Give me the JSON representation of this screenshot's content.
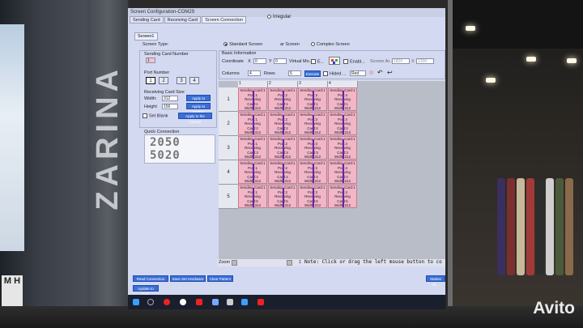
{
  "window": {
    "title": "Screen Configuration-COM29",
    "tabs": [
      "Sending Card",
      "Receiving Card",
      "Screen Connection"
    ],
    "subtab": "Screen1",
    "irregular_label": "Irregular"
  },
  "screen_type": {
    "label": "Screen Type:",
    "options": [
      "Standard Screen",
      "ar Screen",
      "Complex Screen"
    ]
  },
  "sending_card_number": {
    "label": "Sending Card Number",
    "value": "1"
  },
  "port_number": {
    "label": "Port Number",
    "ports": [
      "1",
      "2",
      "3",
      "4"
    ]
  },
  "receiving_card_size": {
    "label": "Receiving Card Size",
    "width_label": "Width:",
    "width_value": "312",
    "height_label": "Height",
    "height_value": "156",
    "apply_all_btn": "Apply to Setting",
    "apply_all_btn2": "Apply to Setting",
    "set_blank_label": "Set Blank",
    "apply_current_btn": "Apply to the Current"
  },
  "quick_connection": {
    "label": "Quick Connection"
  },
  "basic_info": {
    "label": "Basic Information",
    "coordinate_label": "Coordinate",
    "x_label": "X",
    "x_value": "0",
    "y_label": "Y",
    "y_value": "0",
    "virtual_label": "Virtual Mo...",
    "e_label": "E...",
    "enable_label": "Enabl...",
    "screen_ar_label": "Screen Ar...",
    "screen_w": "1820",
    "x_sep": "X",
    "screen_h": "1200",
    "columns_label": "Columns",
    "columns_value": "4",
    "rows_label": "Rows",
    "rows_value": "5",
    "hidden_label": "Hided ...",
    "color_value": "Red",
    "apply_btn": "Execute"
  },
  "grid": {
    "columns": [
      "1",
      "2",
      "3",
      "4"
    ],
    "rows": [
      "1",
      "2",
      "3",
      "4",
      "5"
    ],
    "cells": [
      [
        "Sending Card:1|Port:1|Receiving|Card:1|Width:312",
        "Sending Card:1|Port:2|Receiving|Card:1|Width:312",
        "Sending Card:1|Port:3|Receiving|Card:1|Width:312",
        "Sending Card:1|Port:4|Receiving|Card:1|Width:312"
      ],
      [
        "Sending Card:1|Port:1|Receiving|Card:2|Width:312",
        "Sending Card:1|Port:2|Receiving|Card:2|Width:312",
        "Sending Card:1|Port:3|Receiving|Card:2|Width:312",
        "Sending Card:1|Port:4|Receiving|Card:2|Width:312"
      ],
      [
        "Sending Card:1|Port:1|Receiving|Card:3|Width:312",
        "Sending Card:1|Port:2|Receiving|Card:3|Width:312",
        "Sending Card:1|Port:3|Receiving|Card:3|Width:312",
        "Sending Card:1|Port:4|Receiving|Card:3|Width:312"
      ],
      [
        "Sending Card:1|Port:1|Receiving|Card:4|Width:312",
        "Sending Card:1|Port:2|Receiving|Card:4|Width:312",
        "Sending Card:1|Port:3|Receiving|Card:4|Width:312",
        "Sending Card:1|Port:4|Receiving|Card:4|Width:312"
      ],
      [
        "Sending Card:1|Port:1|Receiving|Card:5|Width:312",
        "Sending Card:1|Port:2|Receiving|Card:5|Width:312",
        "Sending Card:1|Port:3|Receiving|Card:5|Width:312",
        "Sending Card:1|Port:4|Receiving|Card:5|Width:312"
      ]
    ]
  },
  "status_bar": {
    "zoom_label": "Zoom",
    "page": "1",
    "note": "Note: Click or drag the left mouse button to co"
  },
  "bottom_buttons": [
    "Read Connection",
    "Save Set Hardware",
    "Clear Pattern",
    "Station M...",
    "Update to Gain"
  ],
  "quick_digits": [
    "2050",
    "5020"
  ],
  "environment": {
    "brand": "ZARINA",
    "poster_text": "M\nH",
    "watermark": "Avito"
  },
  "colors": {
    "screen_bg": "#d4d9f2",
    "cell_pink": "#f2b6c6",
    "button_blue": "#3b6fd6",
    "route_purple": "#6b21a8"
  }
}
